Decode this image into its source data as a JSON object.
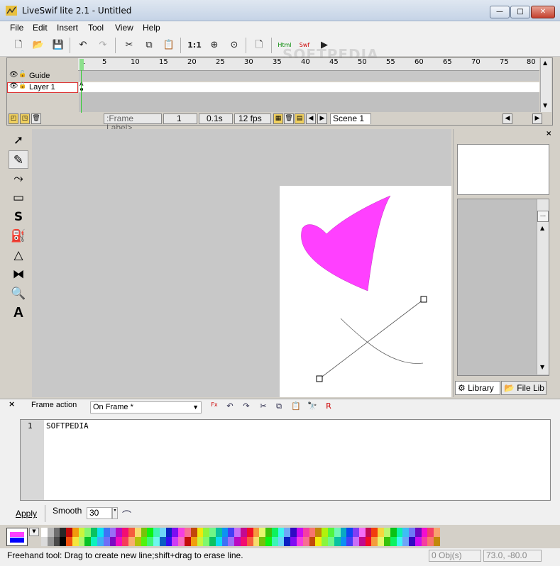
{
  "window": {
    "title": "LiveSwif lite 2.1 - Untitled",
    "min": "—",
    "max": "□",
    "close": "✕"
  },
  "menu": [
    "File",
    "Edit",
    "Insert",
    "Tool",
    "View",
    "Help"
  ],
  "toolbar": {
    "actual_size_label": "1:1",
    "html_label": "Html",
    "swf_label": "Swf"
  },
  "watermark": "SOFTPEDIA",
  "timeline": {
    "ruler_ticks": [
      "1",
      "5",
      "10",
      "15",
      "20",
      "25",
      "30",
      "35",
      "40",
      "45",
      "50",
      "55",
      "60",
      "65",
      "70",
      "75",
      "80"
    ],
    "layers": [
      {
        "name": "Guide"
      },
      {
        "name": "Layer 1"
      }
    ],
    "keyframe_marker": "A",
    "frame_label": ":Frame Label>",
    "current_frame": "1",
    "time": "0.1s",
    "fps": "12 fps",
    "scene_tab": "Scene 1"
  },
  "library": {
    "library_tab": "Library",
    "filelib_tab": "File Lib",
    "list_button": "..."
  },
  "action": {
    "title": "Frame action",
    "event": "On Frame *",
    "line_number": "1",
    "code": "SOFTPEDIA",
    "apply_button": "Apply",
    "smooth_label": "Smooth",
    "smooth_value": "30"
  },
  "colors": {
    "fill": "#ff40ff",
    "stroke": "#0000ff"
  },
  "status": {
    "message": "Freehand tool: Drag to create new line;shift+drag to erase line.",
    "objects": "0 Obj(s)",
    "coords": "73.0, -80.0"
  }
}
